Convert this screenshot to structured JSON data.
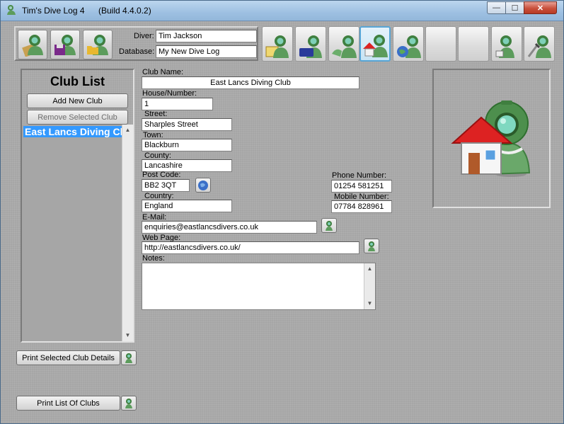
{
  "window": {
    "app_name": "Tim's Dive Log 4",
    "build": "(Build 4.4.0.2)",
    "min_label": "—",
    "max_label": "☐",
    "close_label": "✕"
  },
  "header": {
    "diver_label": "Diver:",
    "diver_value": "Tim Jackson",
    "database_label": "Database:",
    "database_value": "My New Dive Log",
    "file_buttons": [
      {
        "icon": "edit-diver-icon"
      },
      {
        "icon": "save-database-icon"
      },
      {
        "icon": "open-database-icon"
      }
    ],
    "nav_buttons": [
      {
        "icon": "certificates-icon"
      },
      {
        "icon": "equipment-icon"
      },
      {
        "icon": "dive-buddies-icon"
      },
      {
        "icon": "dive-clubs-icon",
        "active": true
      },
      {
        "icon": "dive-sites-icon"
      },
      {
        "icon": "blank-1-icon"
      },
      {
        "icon": "blank-2-icon"
      },
      {
        "icon": "logbook-icon"
      },
      {
        "icon": "tools-icon"
      }
    ]
  },
  "club_list": {
    "title": "Club List",
    "add_button": "Add New Club",
    "remove_button": "Remove Selected Club",
    "items": [
      "East Lancs Diving Club"
    ],
    "print_selected_button": "Print Selected Club Details",
    "print_list_button": "Print List Of Clubs"
  },
  "form": {
    "club_name_label": "Club Name:",
    "club_name": "East Lancs Diving Club",
    "house_label": "House/Number:",
    "house": "1",
    "street_label": "Street:",
    "street": "Sharples Street",
    "town_label": "Town:",
    "town": "Blackburn",
    "county_label": "County:",
    "county": "Lancashire",
    "postcode_label": "Post Code:",
    "postcode": "BB2 3QT",
    "country_label": "Country:",
    "country": "England",
    "phone_label": "Phone Number:",
    "phone": "01254 581251",
    "mobile_label": "Mobile Number:",
    "mobile": "07784 828961",
    "email_label": "E-Mail:",
    "email": "enquiries@eastlancsdivers.co.uk",
    "web_label": "Web Page:",
    "web": "http://eastlancsdivers.co.uk/",
    "notes_label": "Notes:",
    "notes": ""
  },
  "colors": {
    "selection": "#3399ff",
    "panel_bg": "#a6a6a6"
  }
}
